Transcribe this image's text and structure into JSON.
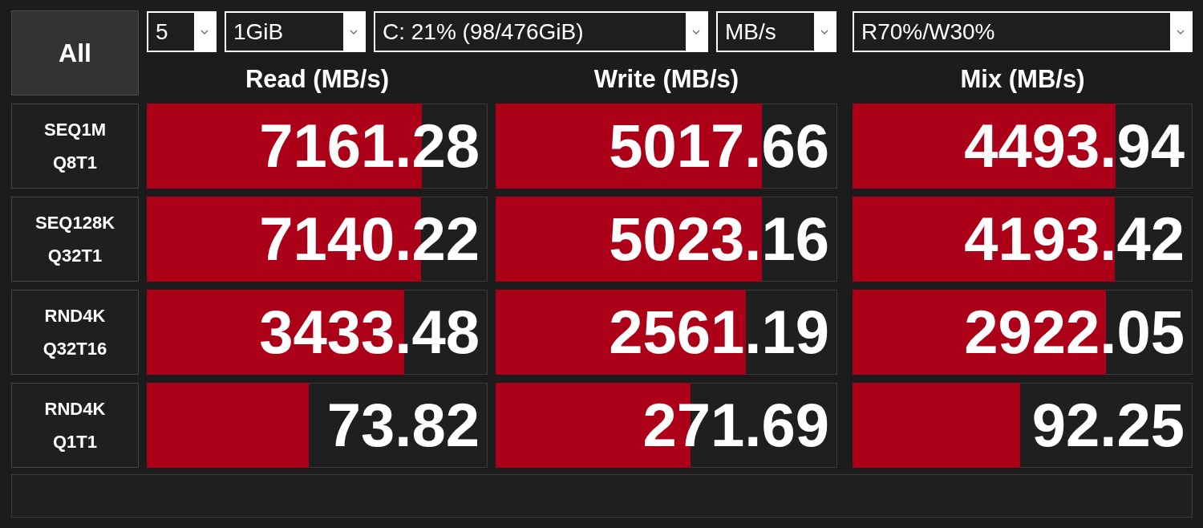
{
  "all_button": {
    "label": "All"
  },
  "dropdowns": [
    {
      "value": "5"
    },
    {
      "value": "1GiB"
    },
    {
      "value": "C: 21% (98/476GiB)"
    },
    {
      "value": "MB/s"
    }
  ],
  "mix_ratio_dropdown": {
    "value": "R70%/W30%"
  },
  "columns": [
    "Read (MB/s)",
    "Write (MB/s)",
    "Mix (MB/s)"
  ],
  "rows": [
    {
      "test": "SEQ1M",
      "params": "Q8T1",
      "results": [
        {
          "value": "7161.28",
          "level": 0.81
        },
        {
          "value": "5017.66",
          "level": 0.784
        },
        {
          "value": "4493.94",
          "level": 0.778
        }
      ]
    },
    {
      "test": "SEQ128K",
      "params": "Q32T1",
      "results": [
        {
          "value": "7140.22",
          "level": 0.809
        },
        {
          "value": "5023.16",
          "level": 0.784
        },
        {
          "value": "4193.42",
          "level": 0.774
        }
      ]
    },
    {
      "test": "RND4K",
      "params": "Q32T16",
      "results": [
        {
          "value": "3433.48",
          "level": 0.758
        },
        {
          "value": "2561.19",
          "level": 0.737
        },
        {
          "value": "2922.05",
          "level": 0.748
        }
      ]
    },
    {
      "test": "RND4K",
      "params": "Q1T1",
      "results": [
        {
          "value": "73.82",
          "level": 0.478
        },
        {
          "value": "271.69",
          "level": 0.573
        },
        {
          "value": "92.25",
          "level": 0.495
        }
      ]
    }
  ]
}
